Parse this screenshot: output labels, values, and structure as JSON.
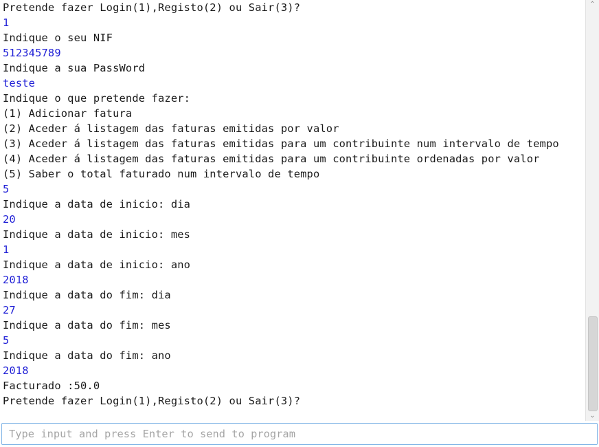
{
  "console": {
    "lines": [
      {
        "text": "Pretende fazer Login(1),Registo(2) ou Sair(3)?",
        "kind": "out"
      },
      {
        "text": "1",
        "kind": "in"
      },
      {
        "text": "Indique o seu NIF",
        "kind": "out"
      },
      {
        "text": "512345789",
        "kind": "in"
      },
      {
        "text": "Indique a sua PassWord",
        "kind": "out"
      },
      {
        "text": "teste",
        "kind": "in"
      },
      {
        "text": "Indique o que pretende fazer:",
        "kind": "out"
      },
      {
        "text": "(1) Adicionar fatura",
        "kind": "out"
      },
      {
        "text": "(2) Aceder á listagem das faturas emitidas por valor",
        "kind": "out"
      },
      {
        "text": "(3) Aceder á listagem das faturas emitidas para um contribuinte num intervalo de tempo",
        "kind": "out"
      },
      {
        "text": "(4) Aceder á listagem das faturas emitidas para um contribuinte ordenadas por valor",
        "kind": "out"
      },
      {
        "text": "(5) Saber o total faturado num intervalo de tempo",
        "kind": "out"
      },
      {
        "text": "5",
        "kind": "in"
      },
      {
        "text": "Indique a data de inicio: dia",
        "kind": "out"
      },
      {
        "text": "20",
        "kind": "in"
      },
      {
        "text": "Indique a data de inicio: mes",
        "kind": "out"
      },
      {
        "text": "1",
        "kind": "in"
      },
      {
        "text": "Indique a data de inicio: ano",
        "kind": "out"
      },
      {
        "text": "2018",
        "kind": "in"
      },
      {
        "text": "Indique a data do fim: dia",
        "kind": "out"
      },
      {
        "text": "27",
        "kind": "in"
      },
      {
        "text": "Indique a data do fim: mes",
        "kind": "out"
      },
      {
        "text": "5",
        "kind": "in"
      },
      {
        "text": "Indique a data do fim: ano",
        "kind": "out"
      },
      {
        "text": "2018",
        "kind": "in"
      },
      {
        "text": "Facturado :50.0",
        "kind": "out"
      },
      {
        "text": "Pretende fazer Login(1),Registo(2) ou Sair(3)?",
        "kind": "out"
      }
    ],
    "colors": {
      "output": "#1a1a1a",
      "user_input": "#1f1fd6"
    }
  },
  "input": {
    "placeholder": "Type input and press Enter to send to program",
    "value": ""
  },
  "scrollbar": {
    "up_icon": "chevron-up-icon",
    "down_icon": "chevron-down-icon"
  }
}
